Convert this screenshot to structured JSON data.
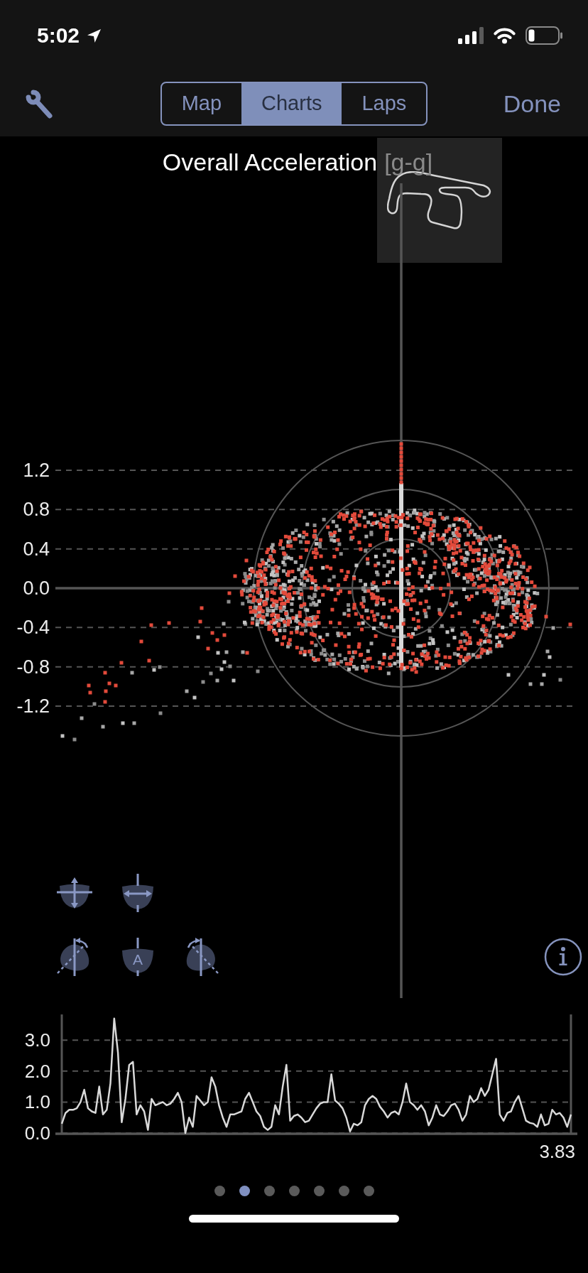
{
  "status_bar": {
    "time": "5:02"
  },
  "nav_bar": {
    "segments": [
      {
        "label": "Map",
        "selected": false
      },
      {
        "label": "Charts",
        "selected": true
      },
      {
        "label": "Laps",
        "selected": false
      }
    ],
    "done": "Done"
  },
  "accel_chart": {
    "title": "Overall Acceleration",
    "unit": "[g-g]",
    "y_tick_labels": [
      "1.2",
      "0.8",
      "0.4",
      "0.0",
      "-0.4",
      "-0.8",
      "-1.2"
    ]
  },
  "view_controls": [
    [
      {
        "kind": "vertical_arrows"
      },
      {
        "kind": "horizontal_arrows"
      }
    ],
    [
      {
        "kind": "rotate_left"
      },
      {
        "kind": "letter",
        "label": "A"
      },
      {
        "kind": "rotate_right"
      }
    ]
  ],
  "trace_chart": {
    "end_label": "3.83",
    "chart_data": {
      "type": "line",
      "grid": true,
      "ylim": [
        0,
        3.83
      ],
      "yticks": [
        {
          "value": 0,
          "label": "0.0"
        },
        {
          "value": 1,
          "label": "1.0"
        },
        {
          "value": 2,
          "label": "2.0"
        },
        {
          "value": 3,
          "label": "3.0"
        }
      ],
      "series": [
        {
          "color": "#d9d9d9",
          "values": [
            0.3,
            0.65,
            0.75,
            0.75,
            0.8,
            1.0,
            1.4,
            0.8,
            0.7,
            0.65,
            1.5,
            0.6,
            0.75,
            1.6,
            3.7,
            2.6,
            0.35,
            1.1,
            2.2,
            2.3,
            0.6,
            0.9,
            0.7,
            0.1,
            1.1,
            0.9,
            0.95,
            1.0,
            0.9,
            0.95,
            1.1,
            1.3,
            1.0,
            0.0,
            0.5,
            0.2,
            1.2,
            1.05,
            0.9,
            1.0,
            1.8,
            1.5,
            0.9,
            0.5,
            0.2,
            0.6,
            0.6,
            0.65,
            0.7,
            1.1,
            1.3,
            1.0,
            0.7,
            0.55,
            0.2,
            0.1,
            0.2,
            0.9,
            0.6,
            1.5,
            2.2,
            0.4,
            0.55,
            0.6,
            0.5,
            0.35,
            0.4,
            0.6,
            0.8,
            0.95,
            1.0,
            1.0,
            1.9,
            1.05,
            0.95,
            0.8,
            0.5,
            0.05,
            0.3,
            0.25,
            0.35,
            0.9,
            1.1,
            1.2,
            1.1,
            0.85,
            0.7,
            0.5,
            0.65,
            0.7,
            0.6,
            1.0,
            1.6,
            1.0,
            0.9,
            0.75,
            0.9,
            0.7,
            0.25,
            0.5,
            0.9,
            0.6,
            0.55,
            0.7,
            0.9,
            0.95,
            0.75,
            0.4,
            0.6,
            1.2,
            1.0,
            1.1,
            1.45,
            1.2,
            1.4,
            1.9,
            2.4,
            0.6,
            0.4,
            0.65,
            0.7,
            1.0,
            1.2,
            0.8,
            0.4,
            0.33,
            0.3,
            0.2,
            0.6,
            0.25,
            0.3,
            0.75,
            0.6,
            0.65,
            0.5,
            0.2,
            0.6
          ]
        }
      ]
    }
  },
  "pages": [
    {
      "selected": false
    },
    {
      "selected": true
    },
    {
      "selected": false
    },
    {
      "selected": false
    },
    {
      "selected": false
    },
    {
      "selected": false
    },
    {
      "selected": false
    }
  ]
}
